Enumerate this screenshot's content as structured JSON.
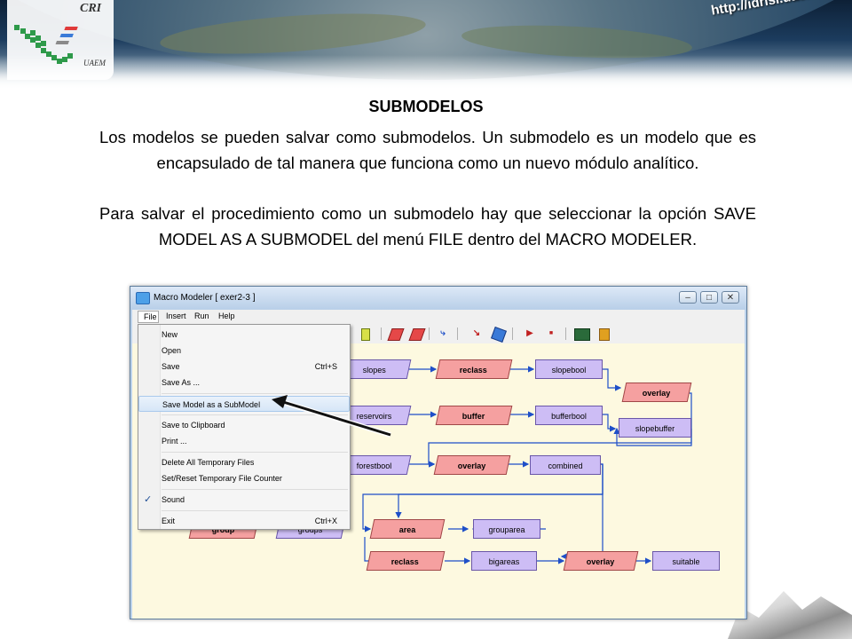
{
  "header": {
    "logo_top_text": "CRI",
    "logo_bottom_text": "UAEM",
    "url": "http://idrisi.uaemex.mx/"
  },
  "slide": {
    "title": "SUBMODELOS",
    "paragraph1": "Los modelos se pueden salvar como submodelos. Un submodelo es un modelo que es encapsulado de tal manera que funciona como un nuevo módulo analítico.",
    "paragraph2": "Para salvar el procedimiento como un submodelo hay que seleccionar la opción SAVE MODEL AS A SUBMODEL del menú FILE dentro del MACRO MODELER."
  },
  "window": {
    "title": "Macro Modeler  [ exer2-3 ]",
    "menus": [
      "File",
      "Insert",
      "Run",
      "Help"
    ],
    "controls": {
      "minimize": "–",
      "maximize": "□",
      "close": "✕"
    }
  },
  "file_menu": {
    "items": [
      {
        "label": "New",
        "shortcut": ""
      },
      {
        "label": "Open",
        "shortcut": ""
      },
      {
        "label": "Save",
        "shortcut": "Ctrl+S"
      },
      {
        "label": "Save As ...",
        "shortcut": ""
      },
      {
        "label": "Save Model as a SubModel",
        "shortcut": ""
      },
      {
        "label": "Save to Clipboard",
        "shortcut": ""
      },
      {
        "label": "Print ...",
        "shortcut": ""
      },
      {
        "label": "Delete All Temporary Files",
        "shortcut": ""
      },
      {
        "label": "Set/Reset Temporary File Counter",
        "shortcut": ""
      },
      {
        "label": "Sound",
        "shortcut": ""
      },
      {
        "label": "Exit",
        "shortcut": "Ctrl+X"
      }
    ],
    "highlighted": "Save Model as a SubModel",
    "checked": "Sound"
  },
  "model": {
    "nodes": {
      "slopes": "slopes",
      "reclass1": "reclass",
      "slopebool": "slopebool",
      "overlay1": "overlay",
      "slopebuffer": "slopebuffer",
      "reservoirs": "reservoirs",
      "buffer": "buffer",
      "bufferbool": "bufferbool",
      "forestbool": "forestbool",
      "overlay2": "overlay",
      "combined": "combined",
      "group": "group",
      "groups": "groups",
      "area": "area",
      "grouparea": "grouparea",
      "reclass2": "reclass",
      "bigareas": "bigareas",
      "overlay3": "overlay",
      "suitable": "suitable"
    }
  },
  "colors": {
    "canvas": "#fdf9e0",
    "data_node": "#cdbdf5",
    "operation_node": "#f5a0a0",
    "link": "#1e4fc8"
  }
}
